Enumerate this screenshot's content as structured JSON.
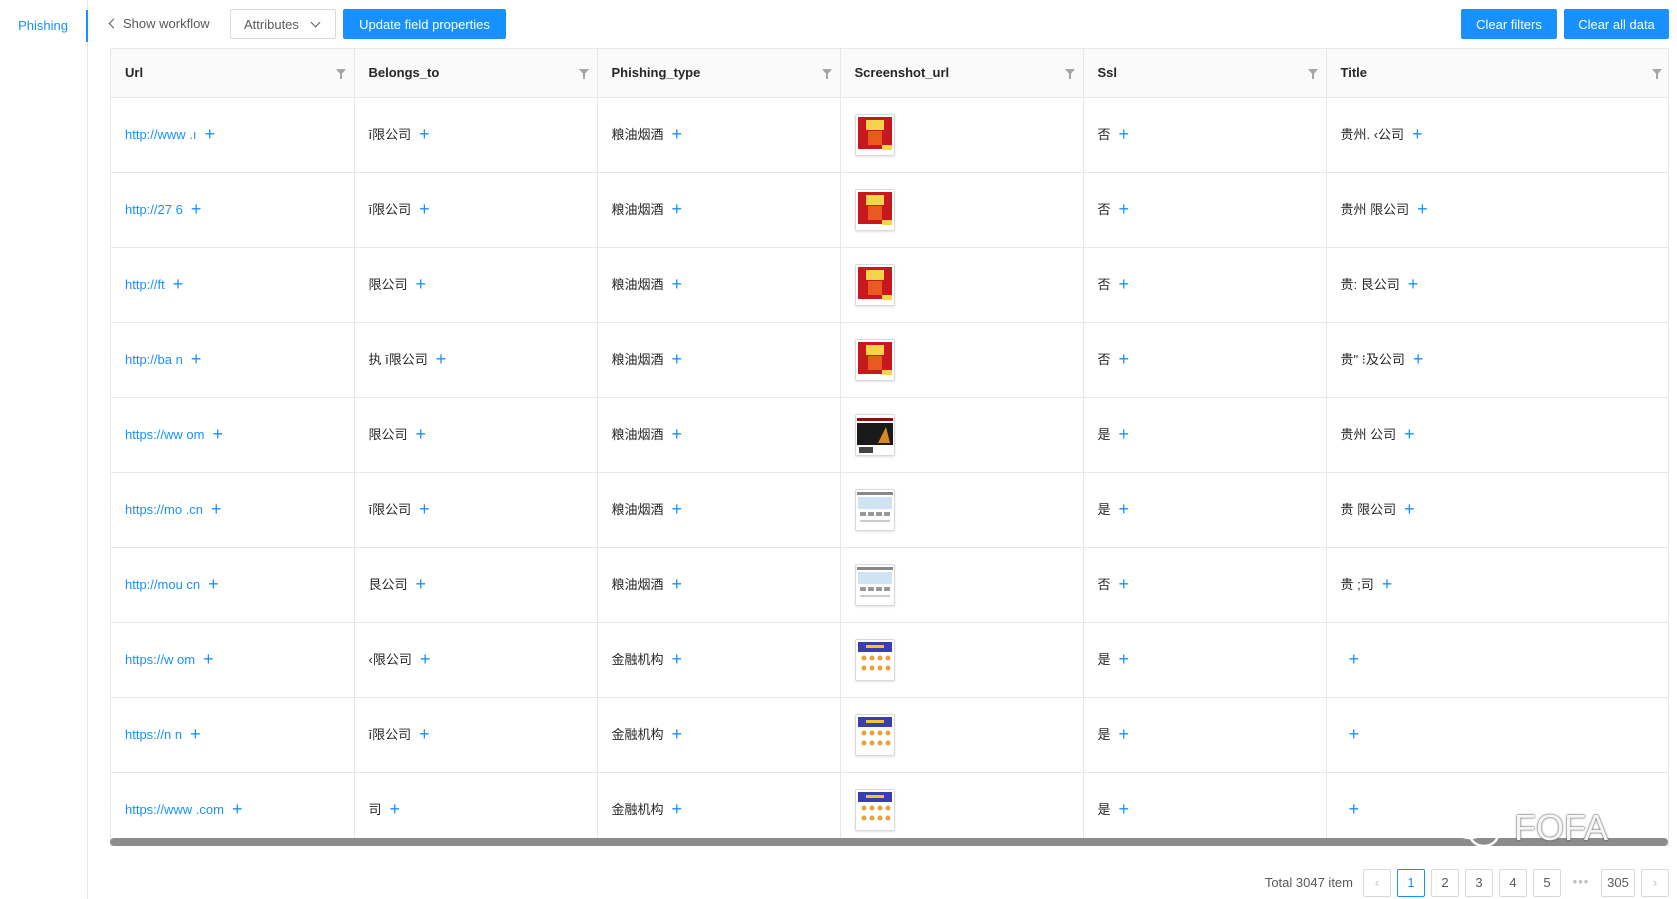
{
  "sidebar": {
    "active_item": "Phishing"
  },
  "toolbar": {
    "show_workflow": "Show workflow",
    "attributes": "Attributes",
    "update_fields": "Update field properties",
    "clear_filters": "Clear filters",
    "clear_all": "Clear all data"
  },
  "columns": [
    "Url",
    "Belongs_to",
    "Phishing_type",
    "Screenshot_url",
    "Ssl",
    "Title"
  ],
  "rows": [
    {
      "url": "http://www          .ı",
      "belongs": "                  ī限公司",
      "type": "粮油烟酒",
      "thumb": "red",
      "ssl": "否",
      "title": "贵州.                 ‹公司"
    },
    {
      "url": "http://27            6",
      "belongs": "                  ī限公司",
      "type": "粮油烟酒",
      "thumb": "red",
      "ssl": "否",
      "title": "贵州                  限公司"
    },
    {
      "url": "http://ft",
      "belongs": "                   限公司",
      "type": "粮油烟酒",
      "thumb": "red",
      "ssl": "否",
      "title": "贵:                   艮公司"
    },
    {
      "url": "http://ba            n",
      "belongs": "执                 ī限公司",
      "type": "粮油烟酒",
      "thumb": "red",
      "ssl": "否",
      "title": "贵\"                  ⁝及公司"
    },
    {
      "url": "https://ww                 om",
      "belongs": "                   限公司",
      "type": "粮油烟酒",
      "thumb": "dark",
      "ssl": "是",
      "title": "贵州                   公司"
    },
    {
      "url": "https://mo               .cn",
      "belongs": "                  ī限公司",
      "type": "粮油烟酒",
      "thumb": "white",
      "ssl": "是",
      "title": "贵                    限公司"
    },
    {
      "url": "http://mou               cn",
      "belongs": "                    艮公司",
      "type": "粮油烟酒",
      "thumb": "white",
      "ssl": "否",
      "title": "贵                     ;司"
    },
    {
      "url": "https://w                om",
      "belongs": "                 ‹限公司",
      "type": "金融机构",
      "thumb": "blue",
      "ssl": "是",
      "title": ""
    },
    {
      "url": "https://n            n",
      "belongs": "                 ī限公司",
      "type": "金融机构",
      "thumb": "blue",
      "ssl": "是",
      "title": ""
    },
    {
      "url": "https://www          .com",
      "belongs": "                    司",
      "type": "金融机构",
      "thumb": "blue",
      "ssl": "是",
      "title": ""
    }
  ],
  "pagination": {
    "total": "Total 3047 item",
    "pages": [
      "1",
      "2",
      "3",
      "4",
      "5"
    ],
    "ellipsis": "•••",
    "last": "305",
    "current": "1"
  },
  "watermark": "FOFA",
  "colors": {
    "primary": "#1890ff",
    "border": "#e8e8e8",
    "header_bg": "#fafafa"
  }
}
